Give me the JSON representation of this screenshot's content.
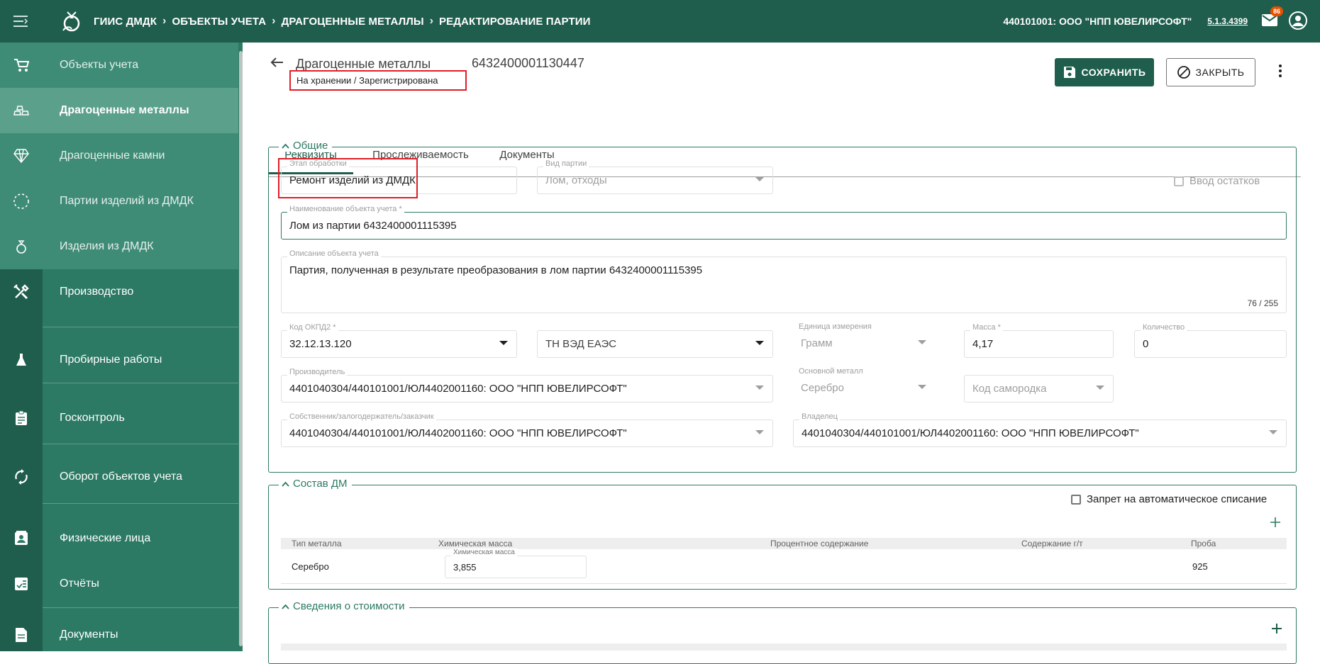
{
  "topbar": {
    "app_name": "ГИИС ДМДК",
    "crumbs": [
      "ОБЪЕКТЫ УЧЕТА",
      "ДРАГОЦЕННЫЕ МЕТАЛЛЫ",
      "РЕДАКТИРОВАНИЕ ПАРТИИ"
    ],
    "org": "440101001: ООО \"НПП ЮВЕЛИРСОФТ\"",
    "version": "5.1.3.4399",
    "mail_count": "86"
  },
  "sidebar": {
    "items": [
      {
        "label": "Объекты учета",
        "icon": "cart-icon"
      },
      {
        "label": "Драгоценные металлы",
        "icon": "gold-bars-icon"
      },
      {
        "label": "Драгоценные камни",
        "icon": "diamond-icon"
      },
      {
        "label": "Партии изделий из ДМДК",
        "icon": "dashed-circle-icon"
      },
      {
        "label": "Изделия из ДМДК",
        "icon": "ring-icon"
      },
      {
        "label": "Производство",
        "icon": "tools-icon"
      },
      {
        "label": "Пробирные работы",
        "icon": "flask-icon"
      },
      {
        "label": "Госконтроль",
        "icon": "clipboard-icon"
      },
      {
        "label": "Оборот объектов учета",
        "icon": "sync-icon"
      },
      {
        "label": "Физические лица",
        "icon": "contact-card-icon"
      },
      {
        "label": "Отчёты",
        "icon": "report-icon"
      },
      {
        "label": "Документы",
        "icon": "document-icon"
      }
    ]
  },
  "header": {
    "title": "Драгоценные металлы",
    "number": "6432400001130447",
    "status": "На хранении / Зарегистрирована",
    "save_label": "СОХРАНИТЬ",
    "close_label": "ЗАКРЫТЬ"
  },
  "tabs": [
    "Реквизиты",
    "Прослеживаемость",
    "Документы"
  ],
  "general": {
    "legend": "Общие",
    "stage_label": "Этап обработки",
    "stage_value": "Ремонт изделий из ДМДК",
    "batch_type_label": "Вид партии",
    "batch_type_value": "Лом, отходы",
    "balance_input_label": "Ввод остатков",
    "name_label": "Наименование объекта учета *",
    "name_value": "Лом из партии 6432400001115395",
    "desc_label": "Описание объекта учета",
    "desc_value": "Партия, полученная в результате преобразования в лом партии 6432400001115395",
    "desc_counter": "76 / 255",
    "okpd_label": "Код ОКПД2 *",
    "okpd_value": "32.12.13.120",
    "tnved_value": "ТН ВЭД ЕАЭС",
    "unit_label": "Единица измерения",
    "unit_value": "Грамм",
    "mass_label": "Масса *",
    "mass_value": "4,17",
    "qty_label": "Количество",
    "qty_value": "0",
    "maker_label": "Производитель",
    "maker_value": "4401040304/440101001/ЮЛ4402001160: ООО \"НПП ЮВЕЛИРСОФТ\"",
    "metal_label": "Основной металл",
    "metal_value": "Серебро",
    "nugget_value": "Код самородка",
    "owner_label": "Собственник/залогодержатель/заказчик",
    "owner_value": "4401040304/440101001/ЮЛ4402001160: ООО \"НПП ЮВЕЛИРСОФТ\"",
    "holder_label": "Владелец",
    "holder_value": "4401040304/440101001/ЮЛ4402001160: ООО \"НПП ЮВЕЛИРСОФТ\""
  },
  "composition": {
    "legend": "Состав ДМ",
    "auto_writeoff_label": "Запрет на автоматическое списание",
    "headers": [
      "Тип металла",
      "Химическая масса",
      "Процентное содержание",
      "Содержание г/т",
      "Проба"
    ],
    "row": {
      "metal": "Серебро",
      "chem_label": "Химическая масса",
      "chem_value": "3,855",
      "probe": "925"
    }
  },
  "cost": {
    "legend": "Сведения о стоимости"
  },
  "colors": {
    "primary": "#1f5e4c",
    "sidebar": "#2d7a64",
    "highlight": "#e01e26",
    "badge": "#e65100"
  }
}
